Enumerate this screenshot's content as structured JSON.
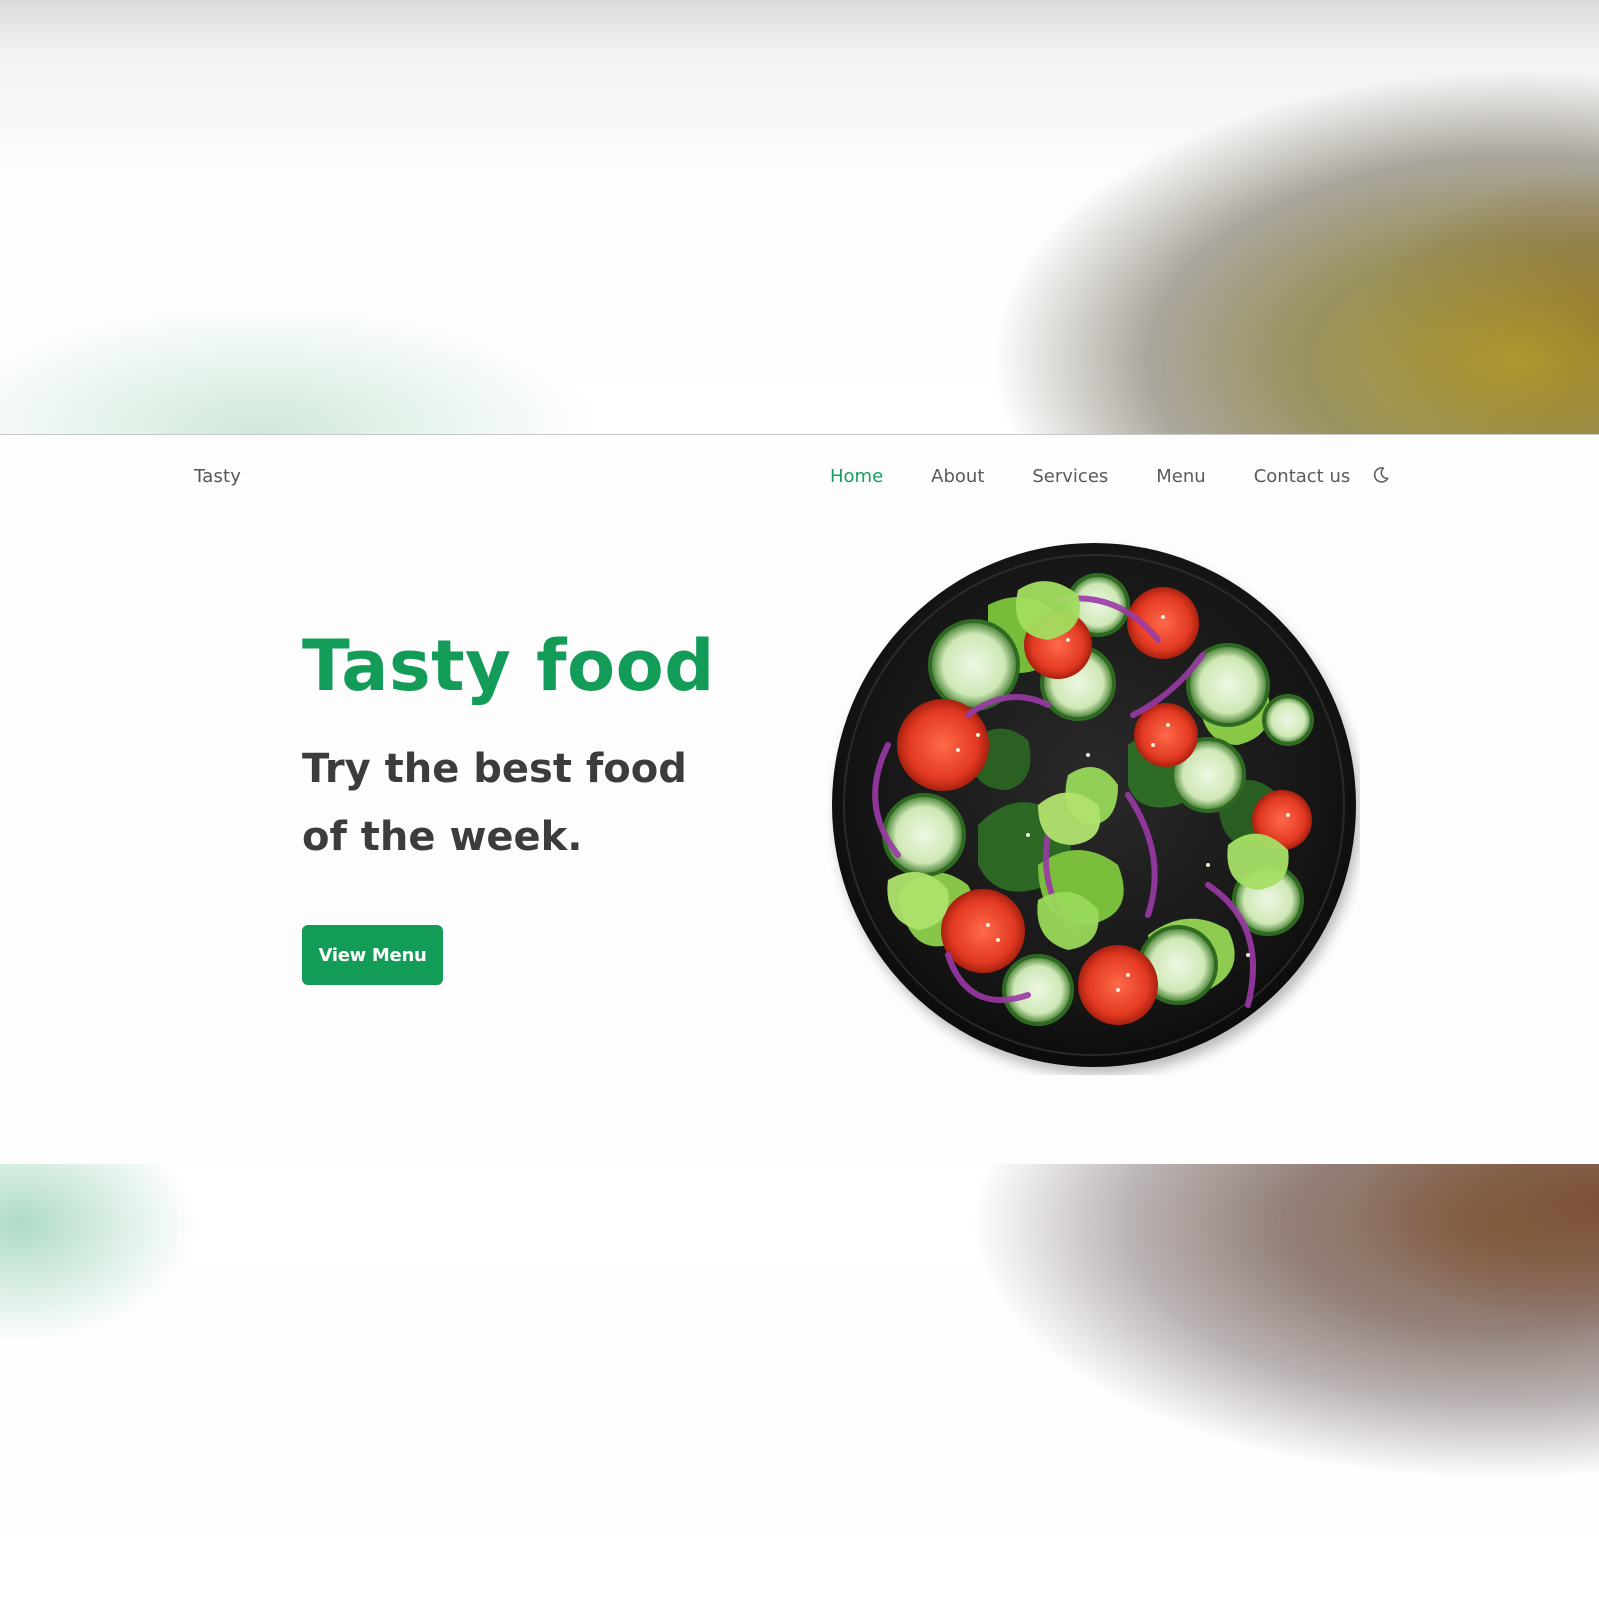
{
  "nav": {
    "logo": "Tasty",
    "links": [
      {
        "label": "Home",
        "active": true
      },
      {
        "label": "About",
        "active": false
      },
      {
        "label": "Services",
        "active": false
      },
      {
        "label": "Menu",
        "active": false
      },
      {
        "label": "Contact us",
        "active": false
      }
    ],
    "theme_toggle_icon": "moon-icon"
  },
  "hero": {
    "title": "Tasty food",
    "subtitle": "Try the best food of the week.",
    "cta_label": "View Menu",
    "image_icon": "salad-bowl-image"
  },
  "colors": {
    "accent": "#129c58",
    "text_dark": "#3c3c3c",
    "text_nav": "#5a5a5a",
    "plate": "#161616"
  }
}
